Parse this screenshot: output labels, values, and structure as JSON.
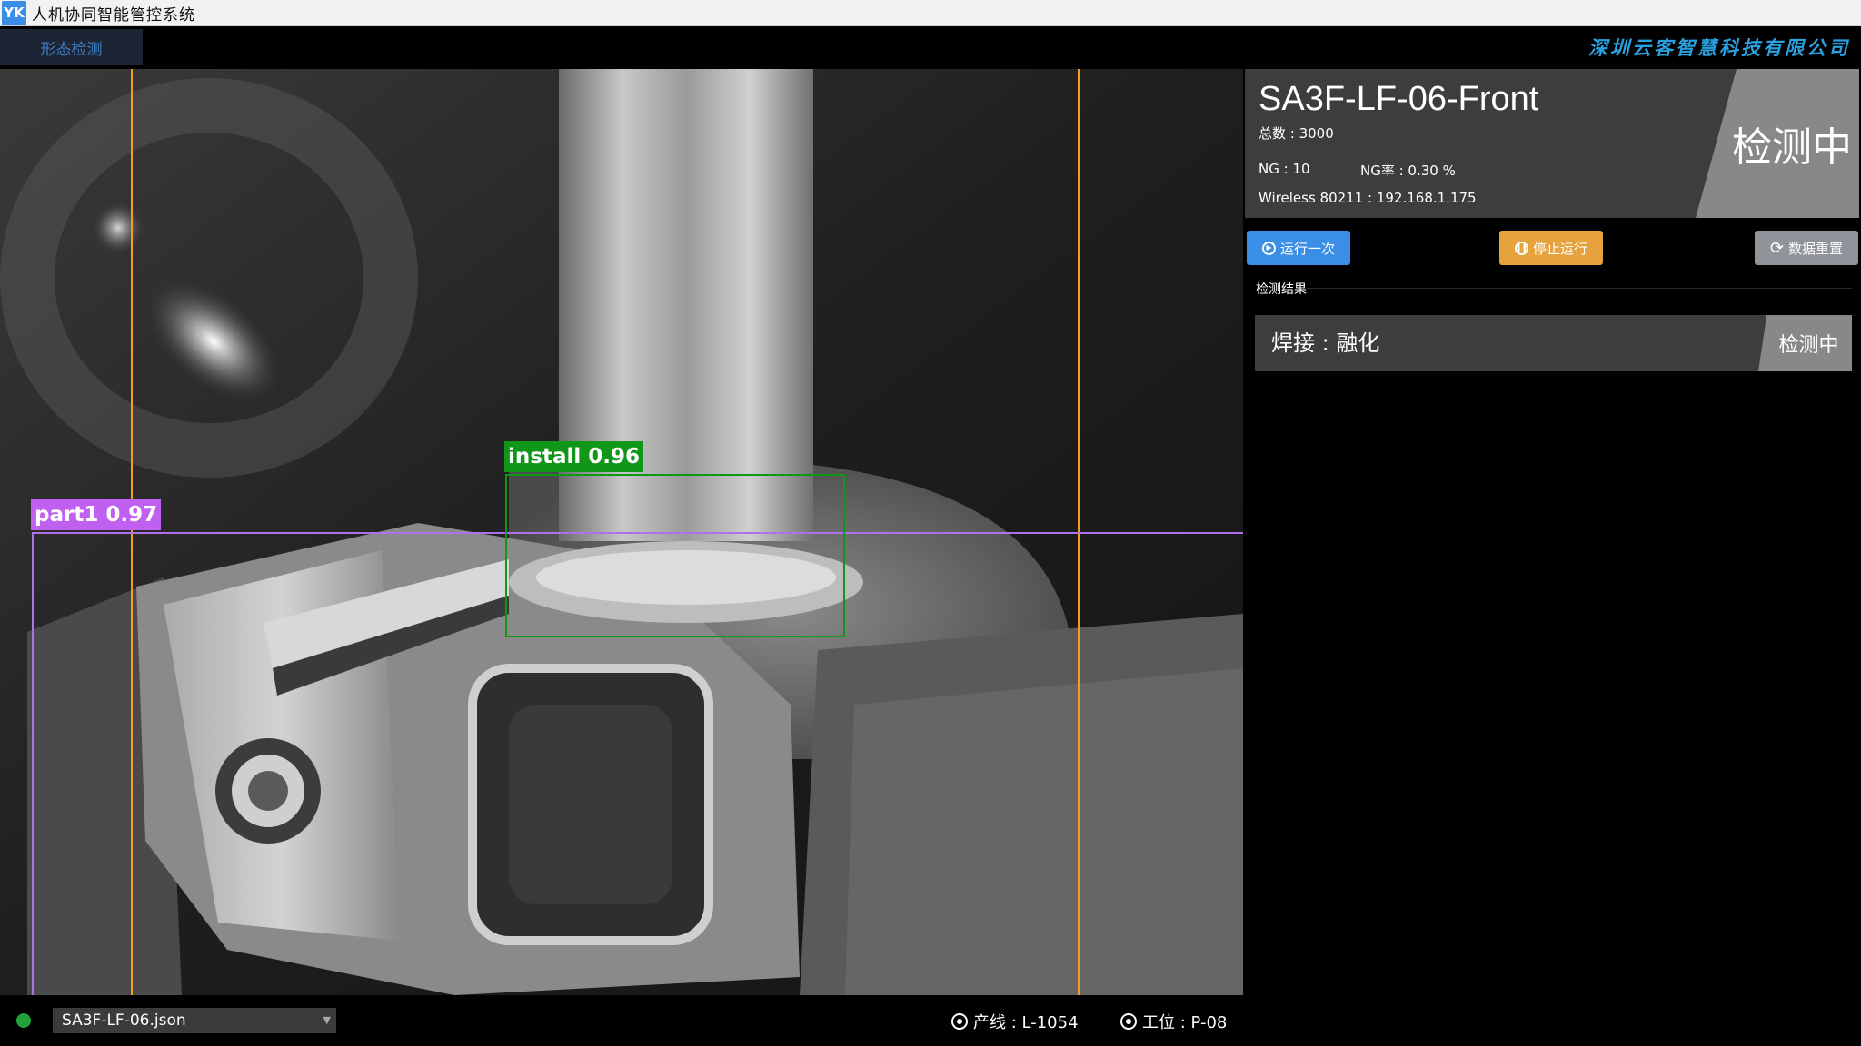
{
  "app": {
    "logo_text": "YK",
    "title": "人机协同智能管控系统"
  },
  "nav": {
    "tab_label": "形态检测",
    "company": "深圳云客智慧科技有限公司"
  },
  "camera": {
    "detections": [
      {
        "label": "install 0.96",
        "color": "#109618"
      },
      {
        "label": "part1 0.97",
        "color": "#c060f0"
      }
    ],
    "guide_line_color": "#f0a020"
  },
  "info": {
    "device_name": "SA3F-LF-06-Front",
    "total": "总数 : 3000",
    "ng": "NG : 10",
    "ng_rate": "NG率 : 0.30 %",
    "wireless": "Wireless 80211 : 192.168.1.175",
    "status": "检测中"
  },
  "buttons": {
    "run_once": "运行一次",
    "stop": "停止运行",
    "reset": "数据重置",
    "colors": {
      "run": "#3a8ee6",
      "stop": "#e6a23c",
      "reset": "#909399"
    }
  },
  "results": {
    "section_title": "检测结果",
    "items": [
      {
        "label": "焊接 : 融化",
        "status": "检测中"
      }
    ]
  },
  "footer": {
    "config_file": "SA3F-LF-06.json",
    "line": "产线 : L-1054",
    "station": "工位 : P-08",
    "status_color": "#1fa33a"
  }
}
